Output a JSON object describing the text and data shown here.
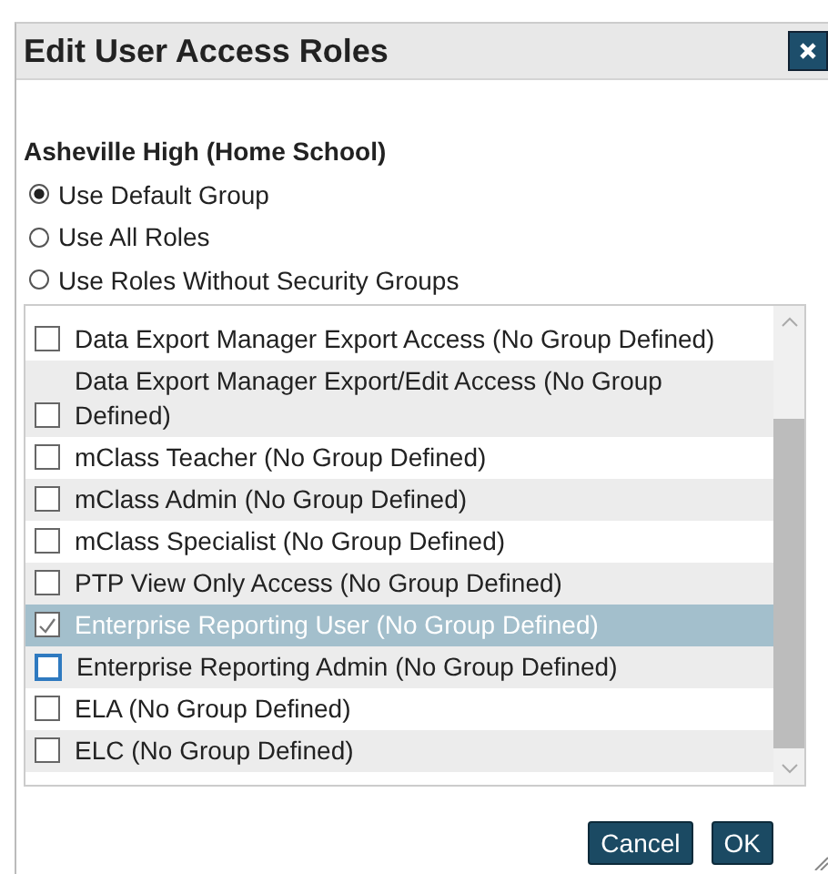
{
  "window": {
    "title": "Edit User Access Roles"
  },
  "school": "Asheville High (Home School)",
  "options": [
    {
      "label": "Use Default Group",
      "selected": true
    },
    {
      "label": "Use All Roles",
      "selected": false
    },
    {
      "label": "Use Roles Without Security Groups",
      "selected": false
    }
  ],
  "roles": [
    {
      "label": "Data Export Manager Export Access (No Group Defined)",
      "checked": false,
      "selected": false,
      "focused": false
    },
    {
      "label": "Data Export Manager Export/Edit Access (No Group Defined)",
      "checked": false,
      "selected": false,
      "focused": false
    },
    {
      "label": "mClass Teacher (No Group Defined)",
      "checked": false,
      "selected": false,
      "focused": false
    },
    {
      "label": "mClass Admin (No Group Defined)",
      "checked": false,
      "selected": false,
      "focused": false
    },
    {
      "label": "mClass Specialist (No Group Defined)",
      "checked": false,
      "selected": false,
      "focused": false
    },
    {
      "label": "PTP View Only Access (No Group Defined)",
      "checked": false,
      "selected": false,
      "focused": false
    },
    {
      "label": "Enterprise Reporting User (No Group Defined)",
      "checked": true,
      "selected": true,
      "focused": false
    },
    {
      "label": "Enterprise Reporting Admin (No Group Defined)",
      "checked": false,
      "selected": false,
      "focused": true
    },
    {
      "label": "ELA (No Group Defined)",
      "checked": false,
      "selected": false,
      "focused": false
    },
    {
      "label": "ELC (No Group Defined)",
      "checked": false,
      "selected": false,
      "focused": false
    }
  ],
  "buttons": [
    {
      "label": "Cancel"
    },
    {
      "label": "OK"
    }
  ]
}
